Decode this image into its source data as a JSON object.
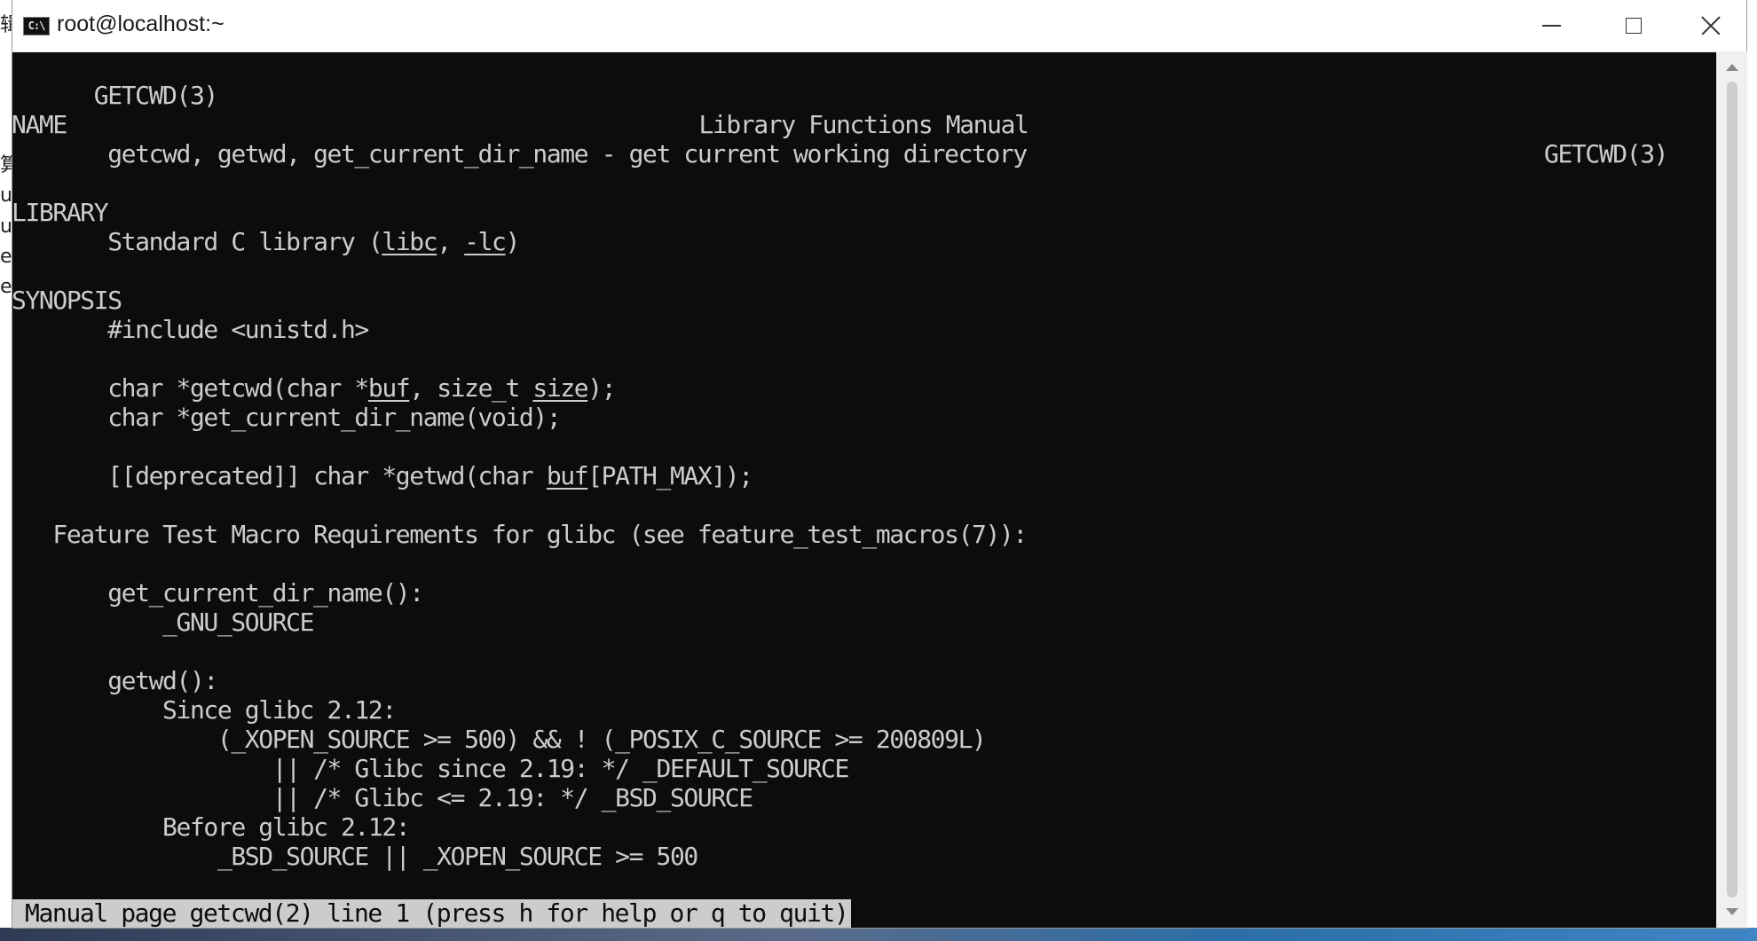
{
  "window": {
    "title": "root@localhost:~",
    "icon": "console-icon",
    "icon_text": "C:\\"
  },
  "background_app": {
    "glyphs": [
      "辑",
      "算",
      "u",
      "u",
      "e",
      "e"
    ]
  },
  "man": {
    "header_left": "GETCWD(3)",
    "header_center": "Library Functions Manual",
    "header_right": "GETCWD(3)",
    "name_heading": "NAME",
    "name_text": "       getcwd, getwd, get_current_dir_name - get current working directory",
    "library_heading": "LIBRARY",
    "library_prefix": "       Standard C library (",
    "library_libc": "libc",
    "library_sep": ", ",
    "library_lc": "-lc",
    "library_suffix": ")",
    "synopsis_heading": "SYNOPSIS",
    "include": "       #include <unistd.h>",
    "proto1_a": "       char *getcwd(char *",
    "proto1_buf": "buf",
    "proto1_b": ", size_t ",
    "proto1_size": "size",
    "proto1_c": ");",
    "proto2": "       char *get_current_dir_name(void);",
    "proto3_a": "       [[deprecated]] char *getwd(char ",
    "proto3_buf": "buf",
    "proto3_b": "[PATH_MAX]);",
    "ftm_heading": "   Feature Test Macro Requirements for glibc (see feature_test_macros(7)):",
    "ftm1_func": "       get_current_dir_name():",
    "ftm1_req": "           _GNU_SOURCE",
    "ftm2_func": "       getwd():",
    "ftm2_since": "           Since glibc 2.12:",
    "ftm2_cond1": "               (_XOPEN_SOURCE >= 500) && ! (_POSIX_C_SOURCE >= 200809L)",
    "ftm2_cond2": "                   || /* Glibc since 2.19: */ _DEFAULT_SOURCE",
    "ftm2_cond3": "                   || /* Glibc <= 2.19: */ _BSD_SOURCE",
    "ftm2_before": "           Before glibc 2.12:",
    "ftm2_before_cond": "               _BSD_SOURCE || _XOPEN_SOURCE >= 500"
  },
  "status": {
    "prompt": "Manual page getcwd(2) line 1 (press h for help or q to quit)"
  },
  "colors": {
    "terminal_bg": "#0c0c0c",
    "terminal_fg": "#cccccc",
    "status_bg": "#cccccc"
  }
}
